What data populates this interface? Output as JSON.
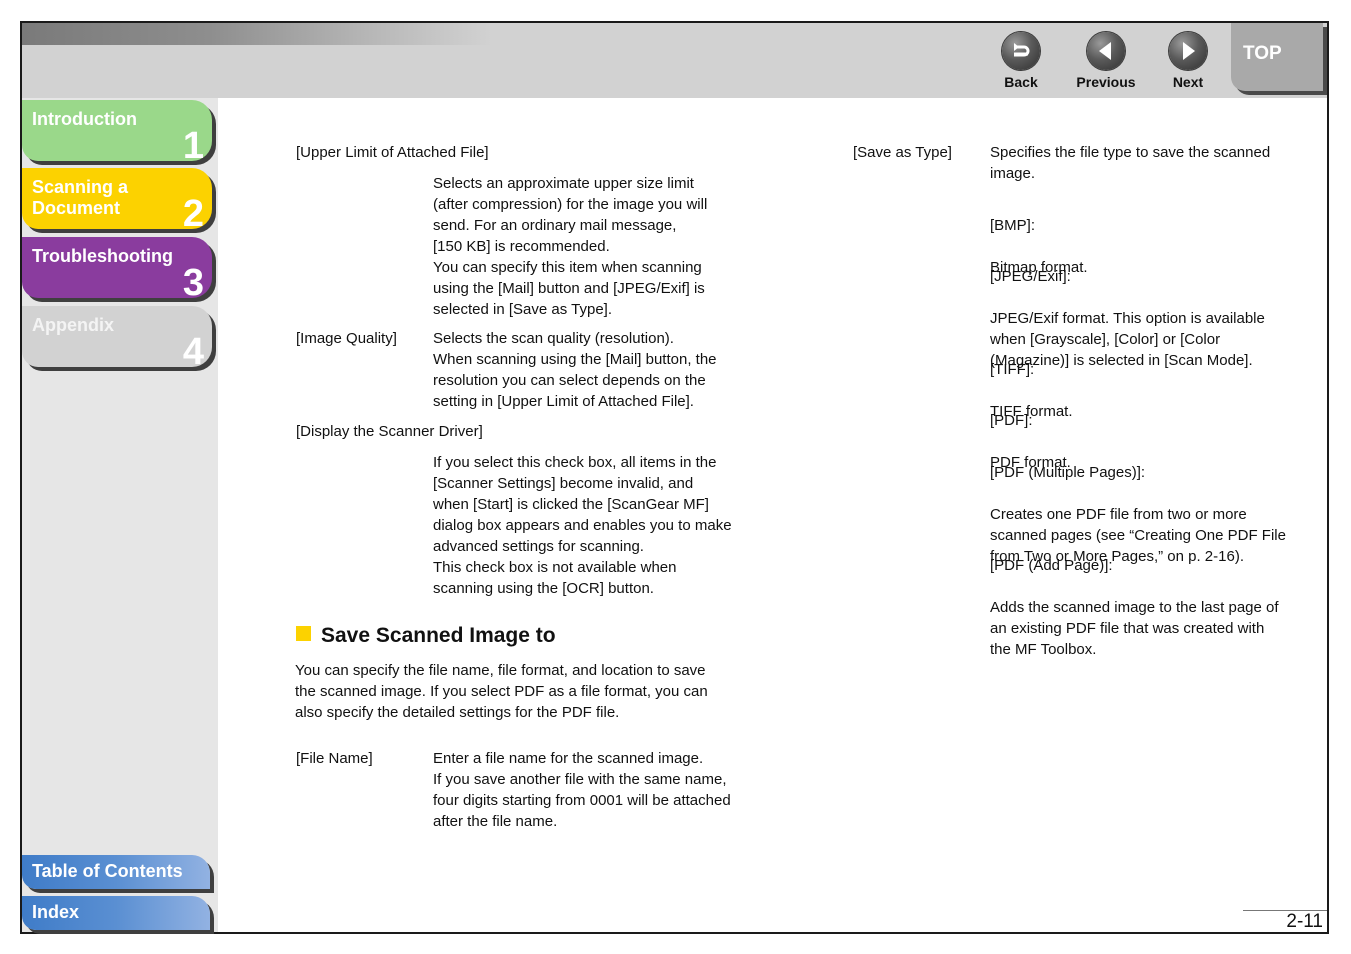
{
  "header": {
    "nav": [
      {
        "label": "Back",
        "icon": "back-arrow-icon"
      },
      {
        "label": "Previous",
        "icon": "left-triangle-icon"
      },
      {
        "label": "Next",
        "icon": "right-triangle-icon"
      }
    ],
    "top_label": "TOP"
  },
  "sidebar": {
    "chapters": [
      {
        "title": "Introduction",
        "number": "1",
        "color": "#9ad88a"
      },
      {
        "title": "Scanning a\nDocument",
        "number": "2",
        "color": "#fcd200"
      },
      {
        "title": "Troubleshooting",
        "number": "3",
        "color": "#8a3c9e"
      },
      {
        "title": "Appendix",
        "number": "4",
        "color": "#d2d2d2"
      }
    ],
    "table_of_contents": "Table of Contents",
    "index": "Index"
  },
  "content": {
    "left": {
      "upper_limit_term": "[Upper Limit of Attached File]",
      "upper_limit_desc": "Selects an approximate upper size limit\n(after compression) for the image you will\nsend. For an ordinary mail message,\n[150 KB] is recommended.\nYou can specify this item when scanning\nusing the [Mail] button and [JPEG/Exif] is\nselected in [Save as Type].",
      "image_quality_term": "[Image Quality]",
      "image_quality_desc": "Selects the scan quality (resolution).\nWhen scanning using the [Mail] button, the\nresolution you can select depends on the\nsetting in [Upper Limit of Attached File].",
      "display_driver_term": "[Display the Scanner Driver]",
      "display_driver_desc": "If you select this check box, all items in the\n[Scanner Settings] become invalid, and\nwhen [Start] is clicked the [ScanGear MF]\ndialog box appears and enables you to make\nadvanced settings for scanning.\nThis check box is not available when\nscanning using the [OCR] button.",
      "section_heading": "Save Scanned Image to",
      "section_intro": "You can specify the file name, file format, and location to save\nthe scanned image. If you select PDF as a file format, you can\nalso specify the detailed settings for the PDF file.",
      "file_name_term": "[File Name]",
      "file_name_desc": "Enter a file name for the scanned image.\nIf you save another file with the same name,\nfour digits starting from 0001 will be attached\nafter the file name."
    },
    "right": {
      "save_as_type_term": "[Save as Type]",
      "save_as_type_desc": "Specifies the file type to save the scanned\nimage.",
      "formats": [
        {
          "name": "[BMP]:",
          "desc": "Bitmap format."
        },
        {
          "name": "[JPEG/Exif]:",
          "desc": "JPEG/Exif format. This option is available\nwhen [Grayscale], [Color] or [Color\n(Magazine)] is selected in [Scan Mode]."
        },
        {
          "name": "[TIFF]:",
          "desc": "TIFF format."
        },
        {
          "name": "[PDF]:",
          "desc": "PDF format."
        },
        {
          "name": "[PDF (Multiple Pages)]:",
          "desc": "Creates one PDF file from two or more\nscanned pages (see “Creating One PDF File\nfrom Two or More Pages,” on p. 2-16)."
        },
        {
          "name": "[PDF (Add Page)]:",
          "desc": "Adds the scanned image to the last page of\nan existing PDF file that was created with\nthe MF Toolbox."
        }
      ]
    }
  },
  "footer": {
    "page_number": "2-11"
  }
}
